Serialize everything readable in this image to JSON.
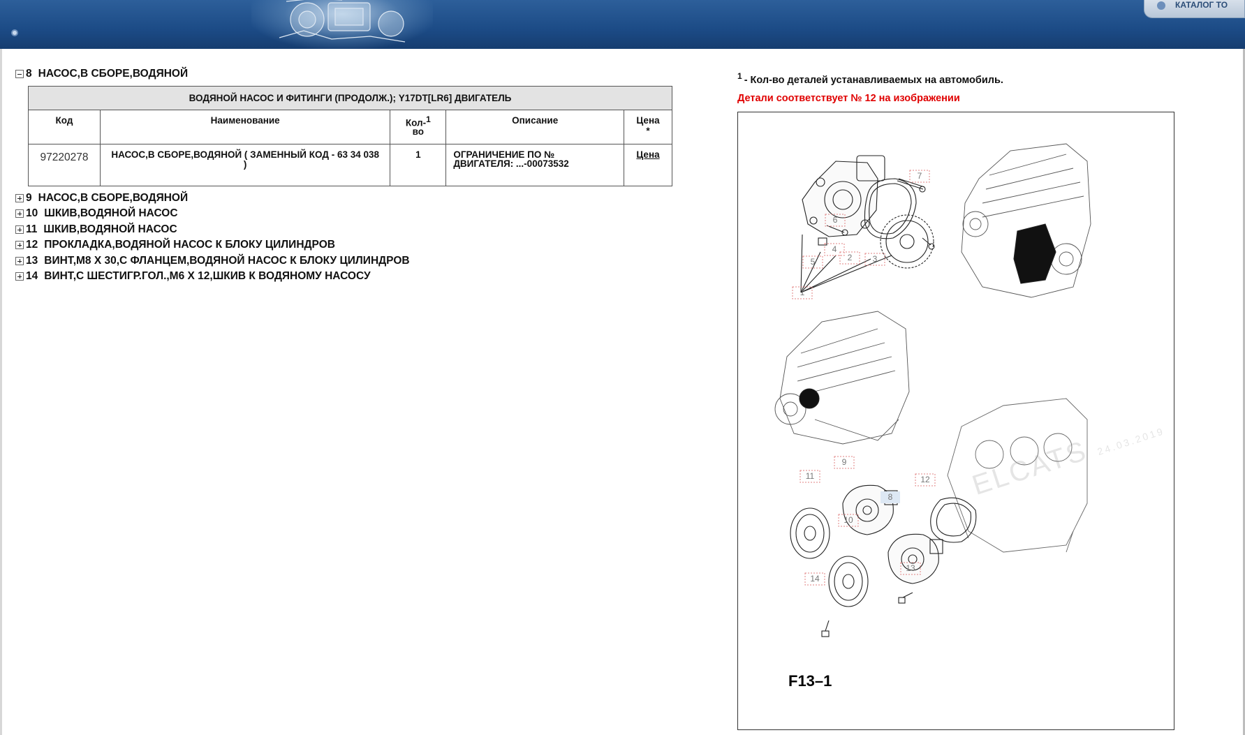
{
  "header": {
    "catalog_button": "КАТАЛОГ ТО"
  },
  "tree": {
    "expanded_node": {
      "num": "8",
      "label": "НАСОС,В СБОРЕ,ВОДЯНОЙ"
    },
    "table": {
      "caption": "ВОДЯНОЙ НАСОС И ФИТИНГИ (ПРОДОЛЖ.); Y17DT[LR6] ДВИГАТЕЛЬ",
      "headers": {
        "code": "Код",
        "name": "Наименование",
        "qty_top": "Кол-",
        "qty_bottom": "во",
        "qty_sup": "1",
        "desc": "Описание",
        "price": "Цена",
        "price_star": "*"
      },
      "rows": [
        {
          "code": "97220278",
          "name": "НАСОС,В СБОРЕ,ВОДЯНОЙ ( ЗАМЕННЫЙ КОД - 63 34 038 )",
          "qty": "1",
          "desc": "ОГРАНИЧЕНИЕ ПО № ДВИГАТЕЛЯ: ...-00073532",
          "price": "Цена"
        }
      ]
    },
    "collapsed_nodes": [
      {
        "num": "9",
        "label": "НАСОС,В СБОРЕ,ВОДЯНОЙ"
      },
      {
        "num": "10",
        "label": "ШКИВ,ВОДЯНОЙ НАСОС"
      },
      {
        "num": "11",
        "label": "ШКИВ,ВОДЯНОЙ НАСОС"
      },
      {
        "num": "12",
        "label": "ПРОКЛАДКА,ВОДЯНОЙ НАСОС К БЛОКУ ЦИЛИНДРОВ"
      },
      {
        "num": "13",
        "label": "ВИНТ,M8 X 30,С ФЛАНЦЕМ,ВОДЯНОЙ НАСОС К БЛОКУ ЦИЛИНДРОВ"
      },
      {
        "num": "14",
        "label": "ВИНТ,С ШЕСТИГР.ГОЛ.,M6 X 12,ШКИВ К ВОДЯНОМУ НАСОСУ"
      }
    ]
  },
  "notes": {
    "qty_sup": "1",
    "qty_note": "- Кол-во деталей устанавливаемых на автомобиль.",
    "match_note": "Детали соответствует № 12 на изображении"
  },
  "figure": {
    "label": "F13–1",
    "watermark": "ELCATS",
    "watermark_date": "24.03.2019",
    "callouts": [
      "1",
      "2",
      "3",
      "4",
      "5",
      "6",
      "7",
      "8",
      "9",
      "10",
      "11",
      "12",
      "13",
      "14"
    ]
  },
  "colors": {
    "header_blue": "#1c4b86",
    "red_note": "#e00000",
    "table_caption_bg": "#e3e3e3"
  }
}
